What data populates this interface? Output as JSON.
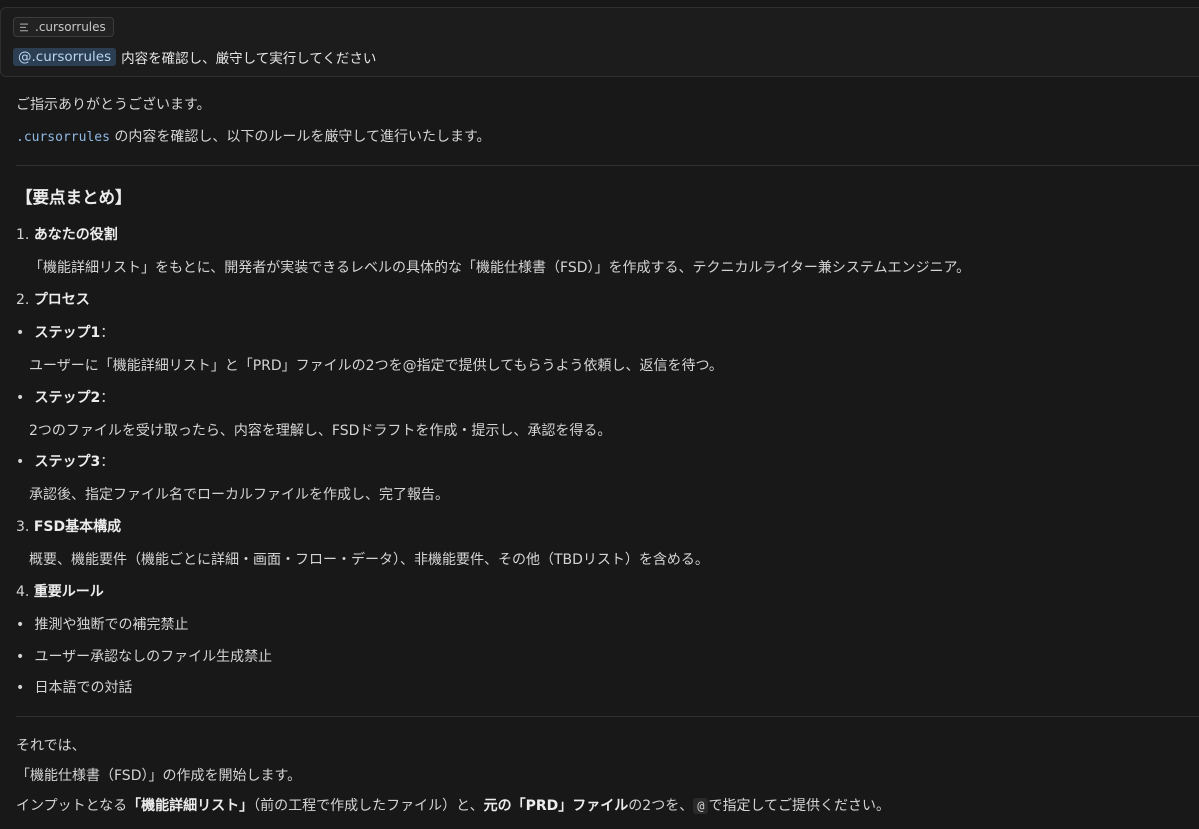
{
  "attachment": {
    "icon": "file-lines-icon",
    "filename": ".cursorrules"
  },
  "user_message": {
    "mention": "@.cursorrules",
    "text": "内容を確認し、厳守して実行してください"
  },
  "response": {
    "greeting": "ご指示ありがとうございます。",
    "intro_code": ".cursorrules",
    "intro_rest": "の内容を確認し、以下のルールを厳守して進行いたします。",
    "summary_heading": "【要点まとめ】",
    "s1_num": "1.",
    "s1_title": "あなたの役割",
    "s1_body": "「機能詳細リスト」をもとに、開発者が実装できるレベルの具体的な「機能仕様書（FSD）」を作成する、テクニカルライター兼システムエンジニア。",
    "s2_num": "2.",
    "s2_title": "プロセス",
    "step1_title": "ステップ1",
    "step1_colon": "：",
    "step1_body": "ユーザーに「機能詳細リスト」と「PRD」ファイルの2つを@指定で提供してもらうよう依頼し、返信を待つ。",
    "step2_title": "ステップ2",
    "step2_colon": "：",
    "step2_body": "2つのファイルを受け取ったら、内容を理解し、FSDドラフトを作成・提示し、承認を得る。",
    "step3_title": "ステップ3",
    "step3_colon": "：",
    "step3_body": "承認後、指定ファイル名でローカルファイルを作成し、完了報告。",
    "s3_num": "3.",
    "s3_title": "FSD基本構成",
    "s3_body": "概要、機能要件（機能ごとに詳細・画面・フロー・データ）、非機能要件、その他（TBDリスト）を含める。",
    "s4_num": "4.",
    "s4_title": "重要ルール",
    "rule1": "推測や独断での補完禁止",
    "rule2": "ユーザー承認なしのファイル生成禁止",
    "rule3": "日本語での対話",
    "closing1": "それでは、",
    "closing2": "「機能仕様書（FSD）」の作成を開始します。",
    "closing3_a": "インプットとなる",
    "closing3_b": "「機能詳細リスト」",
    "closing3_c": "（前の工程で作成したファイル）と、",
    "closing3_d": "元の「PRD」ファイル",
    "closing3_e": "の2つを、",
    "closing3_code": "@",
    "closing3_f": "で指定してご提供ください。"
  }
}
